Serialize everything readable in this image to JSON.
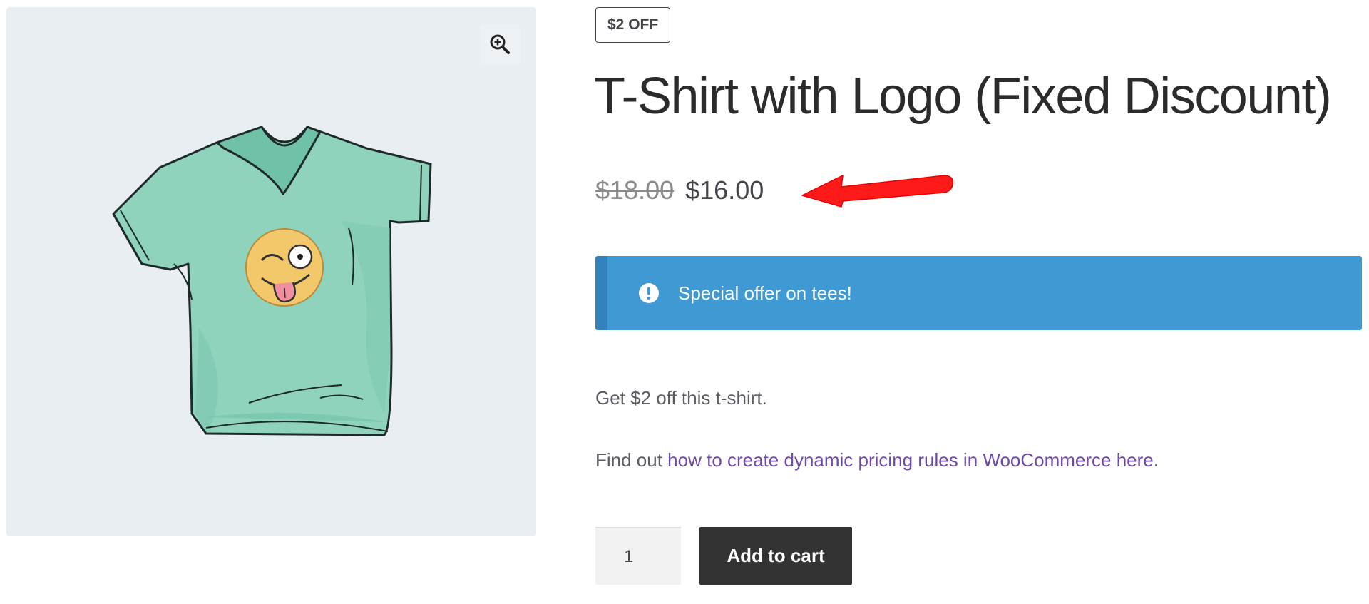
{
  "product": {
    "badge": "$2 OFF",
    "title": "T-Shirt with Logo (Fixed Discount)",
    "regular_price": "$18.00",
    "sale_price": "$16.00"
  },
  "notice": {
    "text": "Special offer on tees!",
    "icon": "info-circle-icon"
  },
  "description": {
    "line1": "Get $2 off this t-shirt.",
    "line2_prefix": "Find out ",
    "line2_link": "how to create dynamic pricing rules in WooCommerce here",
    "line2_suffix": "."
  },
  "cart": {
    "quantity": "1",
    "add_to_cart_label": "Add to cart"
  },
  "colors": {
    "notice_bg": "#3f9ad4",
    "notice_border": "#3182bd",
    "link": "#7049a8",
    "button_bg": "#333333",
    "annotation_arrow": "#ff1a1a"
  },
  "icons": [
    "zoom-in-icon",
    "info-circle-icon",
    "red-arrow-annotation"
  ]
}
